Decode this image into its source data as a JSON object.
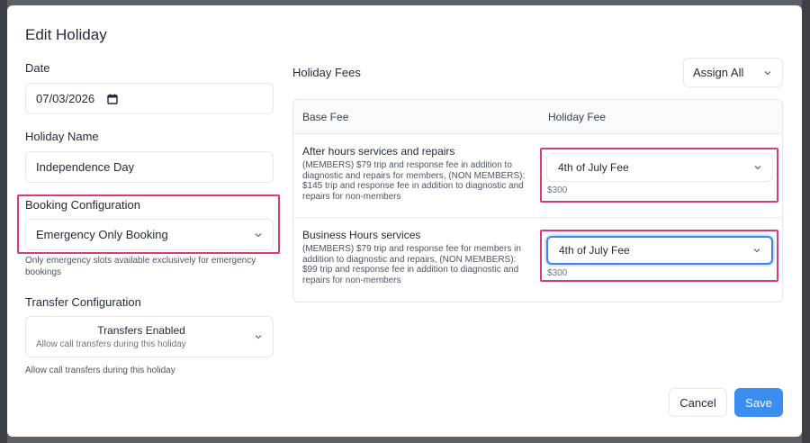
{
  "modal": {
    "title": "Edit Holiday",
    "date": {
      "label": "Date",
      "value": "07/03/2026",
      "icon": "calendar-icon"
    },
    "holiday_name": {
      "label": "Holiday Name",
      "value": "Independence Day"
    },
    "booking": {
      "label": "Booking Configuration",
      "value": "Emergency Only Booking",
      "hint": "Only emergency slots available exclusively for emergency bookings"
    },
    "transfer": {
      "label": "Transfer Configuration",
      "value": "Transfers Enabled",
      "sub": "Allow call transfers during this holiday",
      "hint": "Allow call transfers during this holiday"
    },
    "fees": {
      "title": "Holiday Fees",
      "assign_all": "Assign All",
      "columns": [
        "Base Fee",
        "Holiday Fee"
      ],
      "rows": [
        {
          "name": "After hours services and repairs",
          "description": "(MEMBERS) $79 trip and response fee in addition to diagnostic and repairs for members, (NON MEMBERS): $145 trip and response fee in addition to diagnostic and repairs for non-members",
          "fee": "4th of July Fee",
          "amount": "$300"
        },
        {
          "name": "Business Hours services",
          "description": "(MEMBERS) $79 trip and response fee for members in addition to diagnostic and repairs, (NON MEMBERS): $99 trip and response fee in addition to diagnostic and repairs for non-members",
          "fee": "4th of July Fee",
          "amount": "$300"
        }
      ]
    },
    "buttons": {
      "cancel": "Cancel",
      "save": "Save"
    }
  },
  "colors": {
    "accent": "#3b8ef0",
    "highlight": "#d63b7a",
    "focus": "#3b82f6",
    "backdrop": "#5d6166"
  }
}
